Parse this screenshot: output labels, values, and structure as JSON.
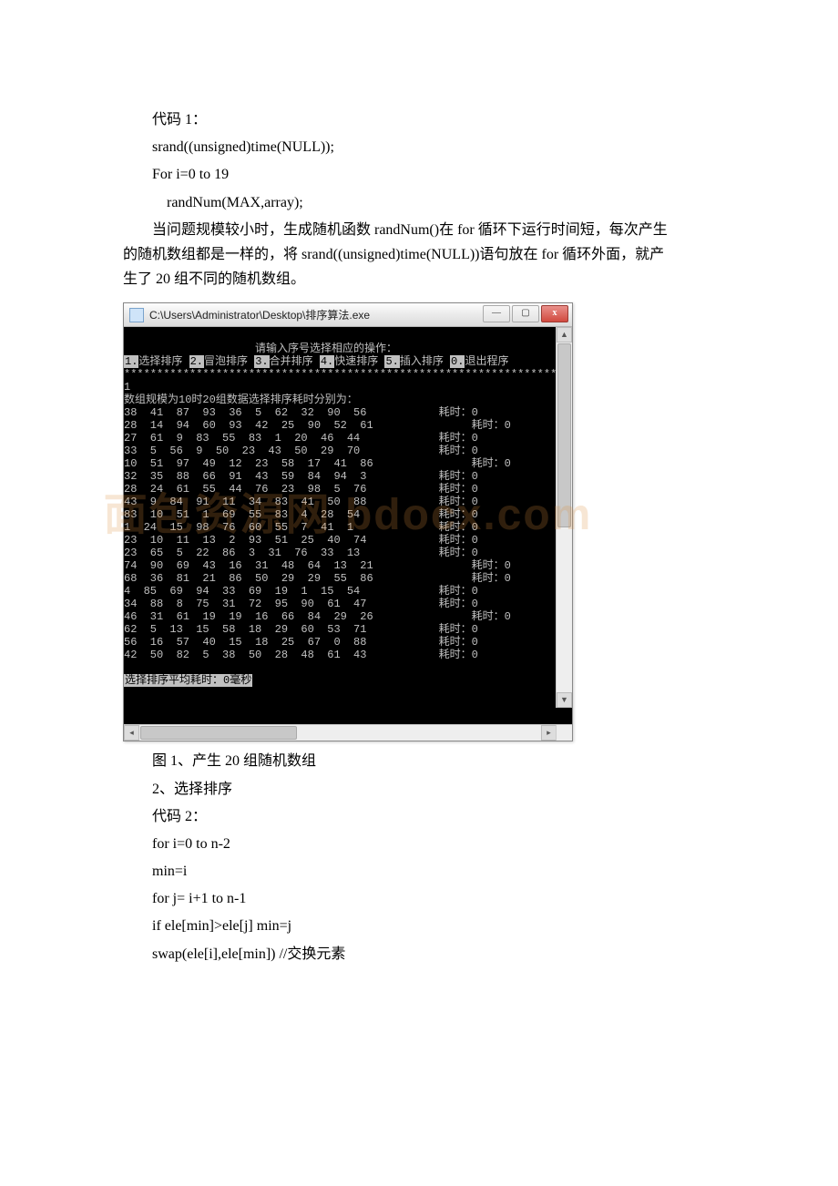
{
  "text": {
    "l1": "代码 1：",
    "l2": "srand((unsigned)time(NULL));",
    "l3": "For i=0 to 19",
    "l4": "randNum(MAX,array);",
    "para1_a": "当问题规模较小时，生成随机函数 randNum()在 for 循环下运行时间短，每次产生",
    "para1_b": "的随机数组都是一样的，将 srand((unsigned)time(NULL))语句放在 for 循环外面，就产",
    "para1_c": "生了 20 组不同的随机数组。",
    "caption": "图 1、产生 20 组随机数组",
    "l5": "2、选择排序",
    "l6": "代码 2：",
    "l7": "for i=0 to n-2",
    "l8": "min=i",
    "l9": "for j= i+1 to n-1",
    "l10": "if ele[min]>ele[j] min=j",
    "l11": "swap(ele[i],ele[min]) //交换元素"
  },
  "window": {
    "title": "C:\\Users\\Administrator\\Desktop\\排序算法.exe",
    "min_label": "—",
    "max_label": "▢",
    "close_label": "х"
  },
  "console": {
    "hdr1": "                    请输入序号选择相应的操作：",
    "hdr2_a": "1.",
    "hdr2_b": "选择排序 ",
    "hdr2_c": "2.",
    "hdr2_d": "冒泡排序 ",
    "hdr2_e": "3.",
    "hdr2_f": "合并排序 ",
    "hdr2_g": "4.",
    "hdr2_h": "快速排序 ",
    "hdr2_i": "5.",
    "hdr2_j": "插入排序 ",
    "hdr2_k": "0.",
    "hdr2_l": "退出程序",
    "stars": "*******************************************************************",
    "input": "1",
    "subhdr": "数组规模为10时20组数据选择排序耗时分别为：",
    "rows": [
      "38  41  87  93  36  5  62  32  90  56           耗时：0",
      "28  14  94  60  93  42  25  90  52  61               耗时：0",
      "27  61  9  83  55  83  1  20  46  44            耗时：0",
      "33  5  56  9  50  23  43  50  29  70            耗时：0",
      "10  51  97  49  12  23  58  17  41  86               耗时：0",
      "32  35  88  66  91  43  59  84  94  3           耗时：0",
      "28  24  61  55  44  76  23  98  5  76           耗时：0",
      "43  9  84  91  11  34  83  41  50  88           耗时：0",
      "83  10  51  1  69  55  83  4  28  54            耗时：0",
      "1  24  15  98  76  60  55  7  41  1             耗时：0",
      "23  10  11  13  2  93  51  25  40  74           耗时：0",
      "23  65  5  22  86  3  31  76  33  13            耗时：0",
      "74  90  69  43  16  31  48  64  13  21               耗时：0",
      "68  36  81  21  86  50  29  29  55  86               耗时：0",
      "4  85  69  94  33  69  19  1  15  54            耗时：0",
      "34  88  8  75  31  72  95  90  61  47           耗时：0",
      "46  31  61  19  19  16  66  84  29  26               耗时：0",
      "62  5  13  15  58  18  29  60  53  71           耗时：0",
      "56  16  57  40  15  18  25  67  0  88           耗时：0",
      "42  50  82  5  38  50  28  48  61  43           耗时：0"
    ],
    "footer_a": "选择排序平均耗时：0毫秒"
  },
  "watermark": "面包资源网  bdocx.com"
}
